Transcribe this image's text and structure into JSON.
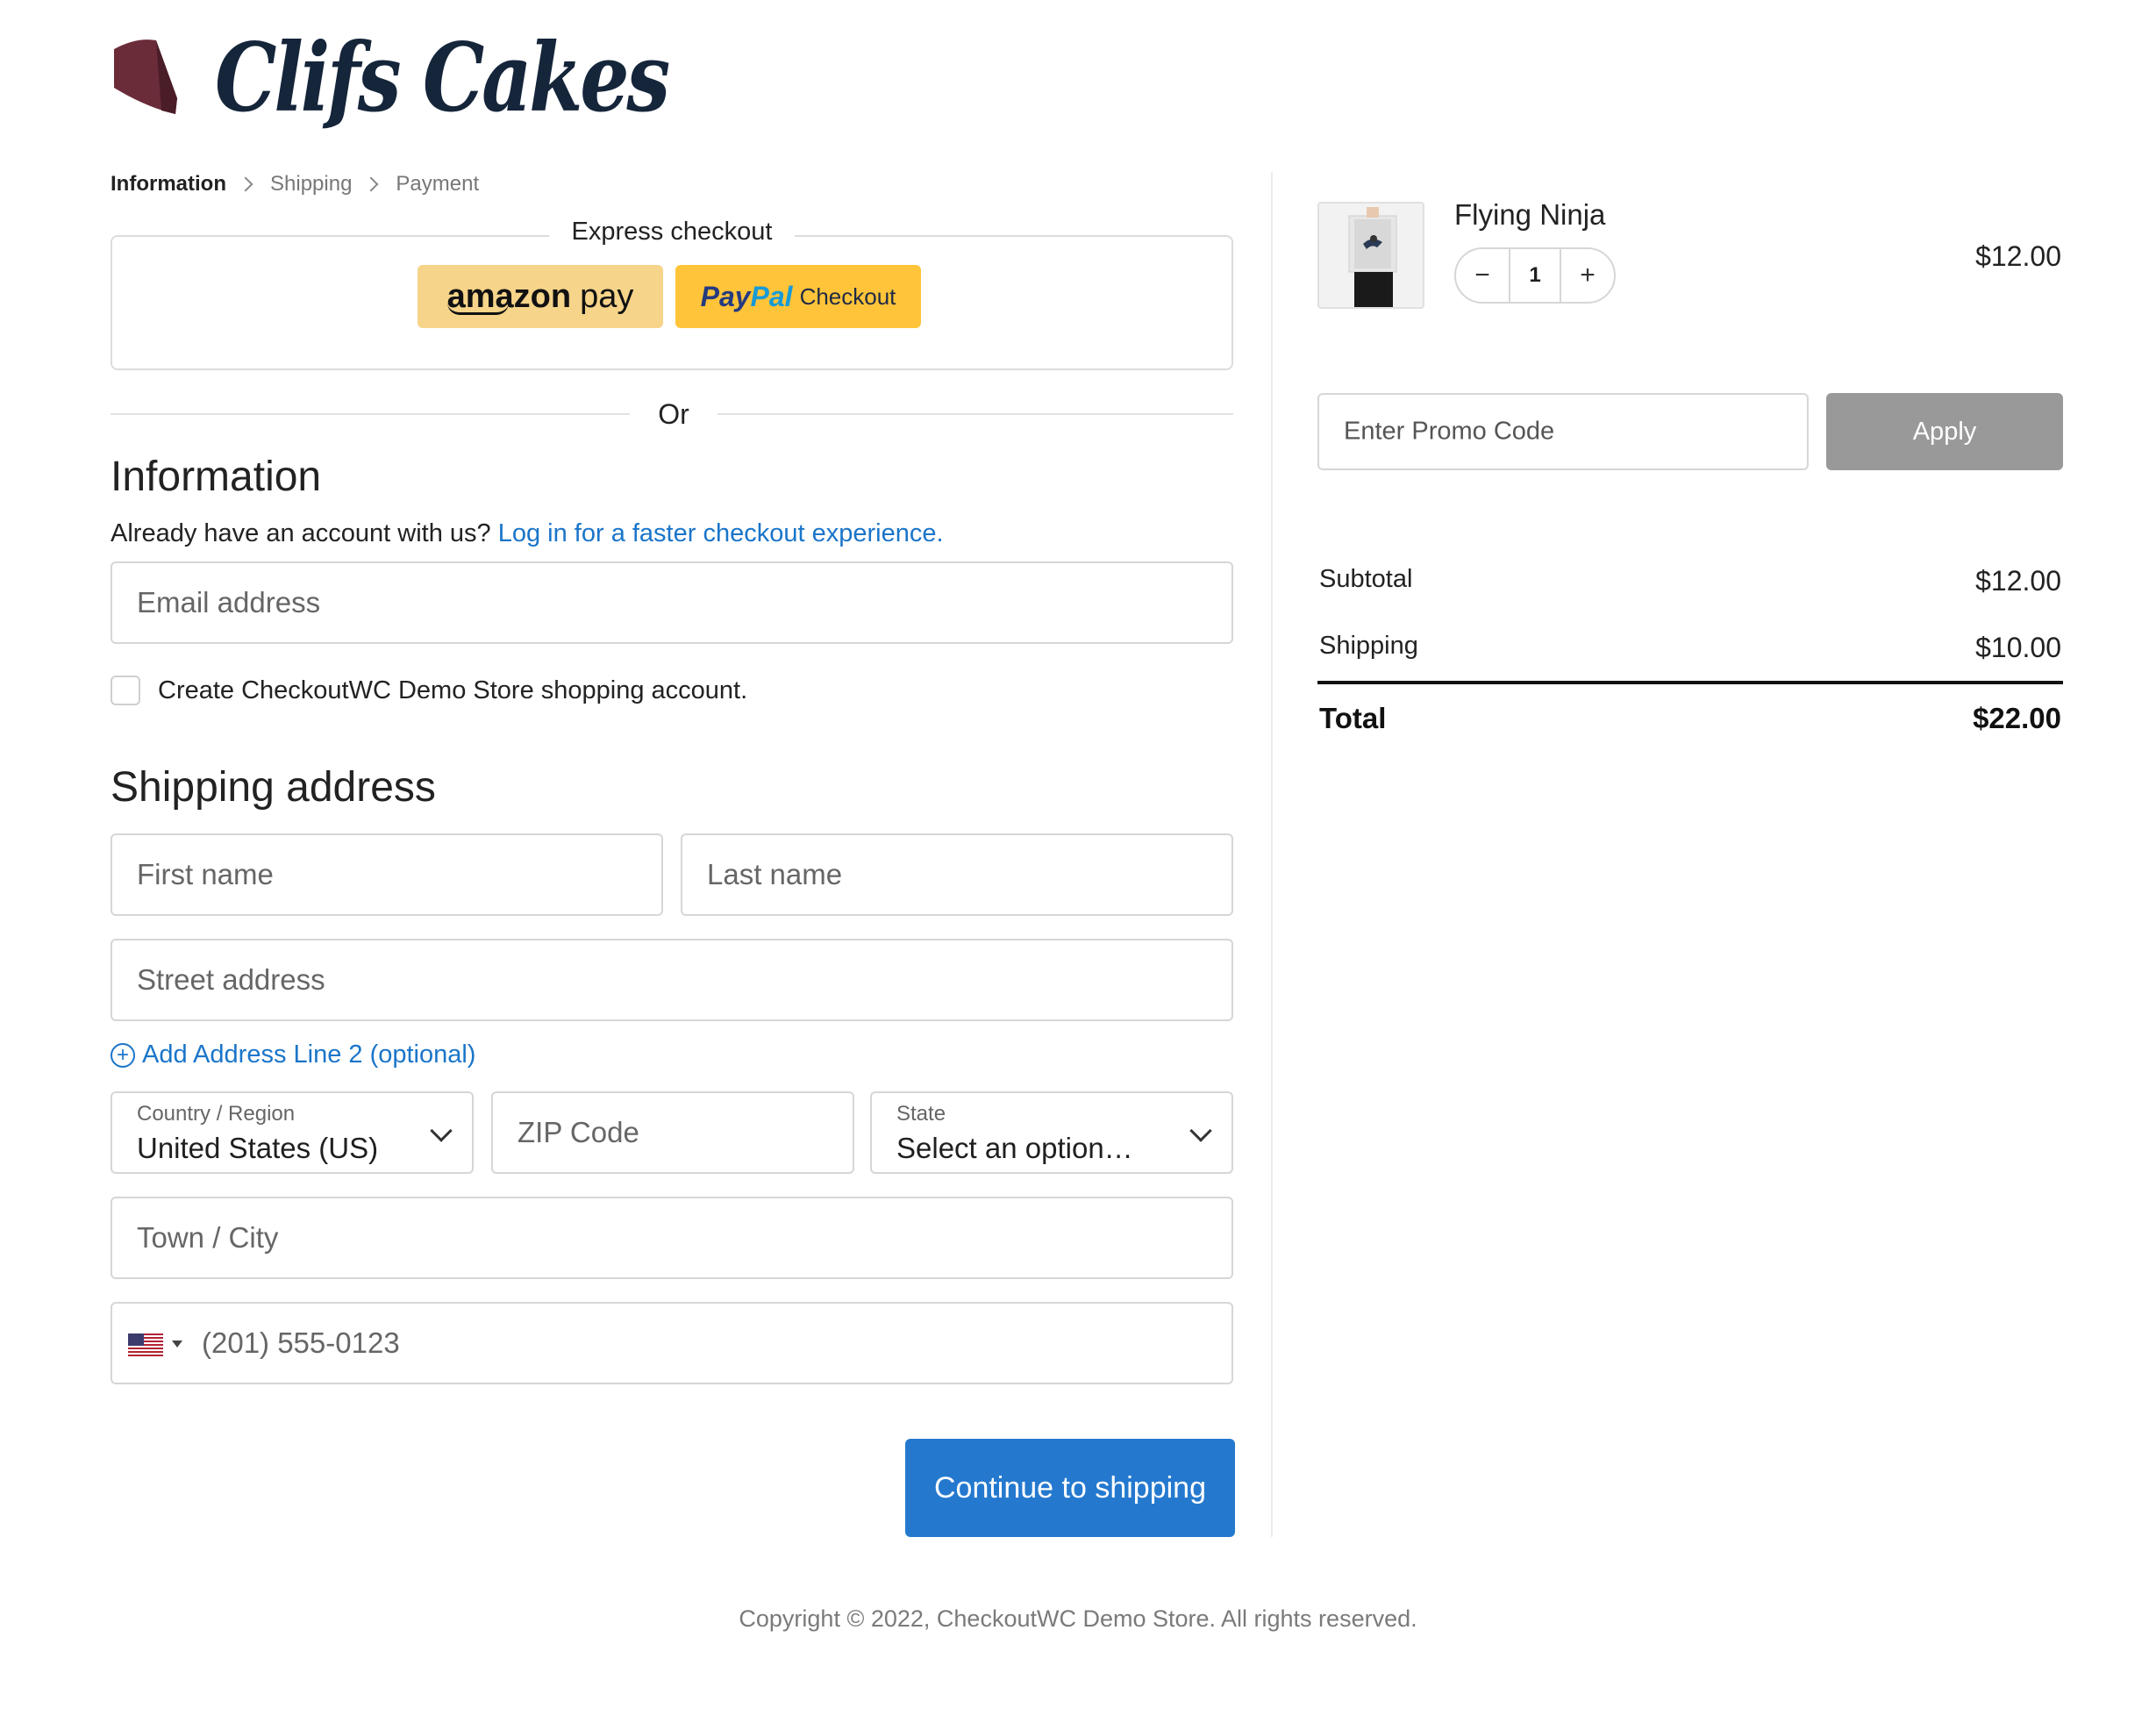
{
  "brand": {
    "name": "Clifs Cakes",
    "logo_icon": "cake-slice-icon",
    "logo_color": "#6b2c3a",
    "text_color": "#15253a"
  },
  "breadcrumb": [
    {
      "label": "Information",
      "current": true
    },
    {
      "label": "Shipping",
      "current": false
    },
    {
      "label": "Payment",
      "current": false
    }
  ],
  "express": {
    "legend": "Express checkout",
    "amazon": {
      "brand": "amazon",
      "suffix": "pay",
      "color": "#f6d489"
    },
    "paypal": {
      "pay": "Pay",
      "pal": "Pal",
      "suffix": "Checkout",
      "color": "#ffc439"
    }
  },
  "divider_text": "Or",
  "information": {
    "heading": "Information",
    "login_prompt": "Already have an account with us?",
    "login_link": "Log in for a faster checkout experience.",
    "email_placeholder": "Email address",
    "create_account_label": "Create CheckoutWC Demo Store shopping account."
  },
  "shipping_address": {
    "heading": "Shipping address",
    "first_name_placeholder": "First name",
    "last_name_placeholder": "Last name",
    "street_placeholder": "Street address",
    "add_line2": "Add Address Line 2 (optional)",
    "country_label": "Country / Region",
    "country_value": "United States (US)",
    "zip_placeholder": "ZIP Code",
    "state_label": "State",
    "state_value": "Select an option…",
    "town_placeholder": "Town / City",
    "phone_placeholder": "(201) 555-0123",
    "phone_flag_icon": "us-flag-icon"
  },
  "continue_button": "Continue to shipping",
  "accent_color": "#2479cf",
  "cart": {
    "product_name": "Flying Ninja",
    "quantity": "1",
    "qty_minus": "−",
    "qty_plus": "+",
    "price": "$12.00"
  },
  "promo": {
    "placeholder": "Enter Promo Code",
    "apply_label": "Apply"
  },
  "summary": {
    "subtotal_label": "Subtotal",
    "subtotal_value": "$12.00",
    "shipping_label": "Shipping",
    "shipping_value": "$10.00",
    "total_label": "Total",
    "total_value": "$22.00"
  },
  "footer": {
    "copyright": "Copyright © 2022, CheckoutWC Demo Store. All rights reserved."
  }
}
